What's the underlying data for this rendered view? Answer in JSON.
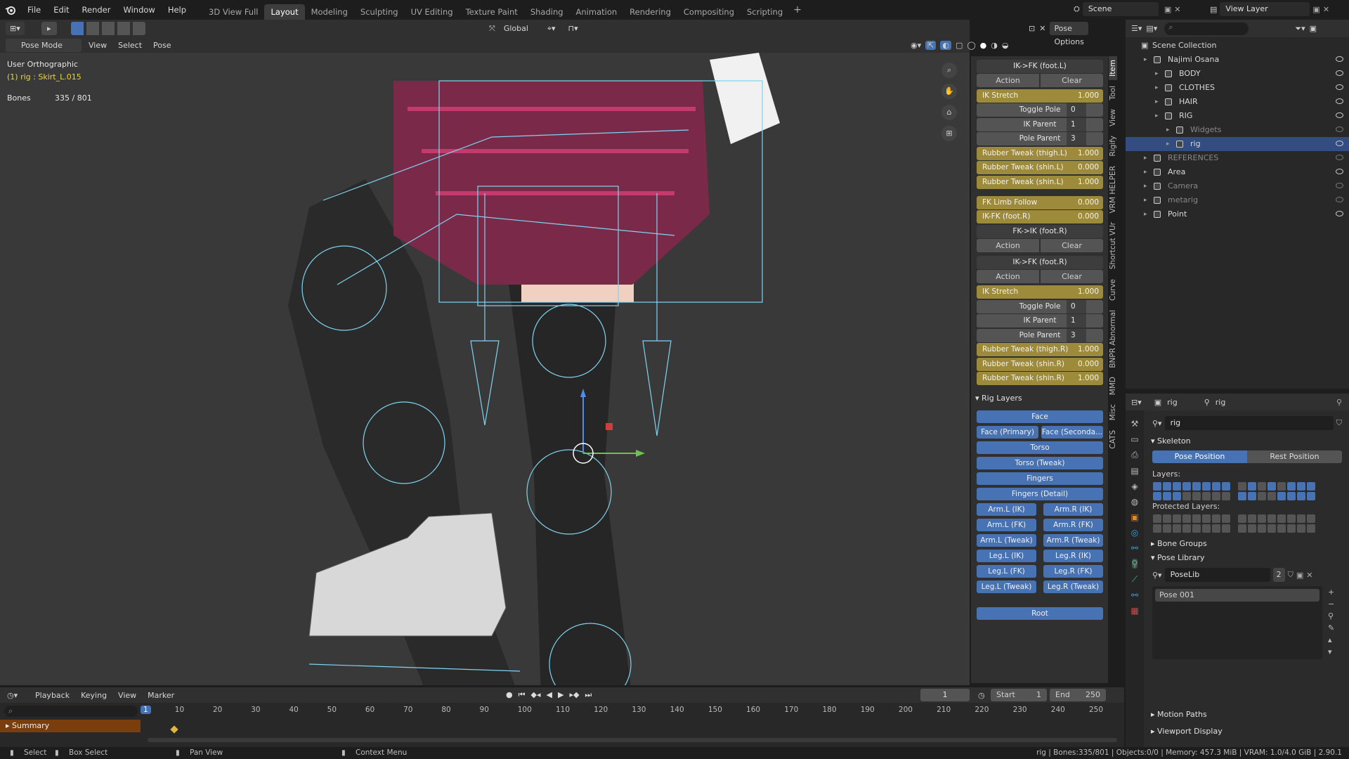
{
  "menu": {
    "file": "File",
    "edit": "Edit",
    "render": "Render",
    "window": "Window",
    "help": "Help"
  },
  "workspaces": [
    "3D View Full",
    "Layout",
    "Modeling",
    "Sculpting",
    "UV Editing",
    "Texture Paint",
    "Shading",
    "Animation",
    "Rendering",
    "Compositing",
    "Scripting"
  ],
  "active_workspace": "Layout",
  "scene": "Scene",
  "view_layer": "View Layer",
  "viewport": {
    "mode": "Pose Mode",
    "menus": [
      "View",
      "Select",
      "Pose"
    ],
    "transform_orientation": "Global",
    "pose_options": "Pose Options",
    "overlay_view": "User Orthographic",
    "overlay_object": "(1) rig : Skirt_L.015",
    "bones_label": "Bones",
    "bones_value": "335 / 801"
  },
  "npanel": {
    "ikfk_foot_l": "IK->FK (foot.L)",
    "action": "Action",
    "clear": "Clear",
    "ik_stretch": "IK Stretch",
    "ik_stretch_val": "1.000",
    "toggle_pole": "Toggle Pole",
    "toggle_pole_val": "0",
    "ik_parent": "IK Parent",
    "ik_parent_val": "1",
    "pole_parent": "Pole Parent",
    "pole_parent_val": "3",
    "rt_thigh_l": "Rubber Tweak (thigh.L)",
    "rt_thigh_l_val": "1.000",
    "rt_shin_l1": "Rubber Tweak (shin.L)",
    "rt_shin_l1_val": "0.000",
    "rt_shin_l2": "Rubber Tweak (shin.L)",
    "rt_shin_l2_val": "1.000",
    "fk_limb_follow": "FK Limb Follow",
    "fk_limb_follow_val": "0.000",
    "ikfk_foot_r_slider": "IK-FK (foot.R)",
    "ikfk_foot_r_slider_val": "0.000",
    "fkik_foot_r": "FK->IK (foot.R)",
    "ikfk_foot_r": "IK->FK (foot.R)",
    "ik_stretch2_val": "1.000",
    "toggle_pole2_val": "0",
    "ik_parent2_val": "1",
    "pole_parent2_val": "3",
    "rt_thigh_r": "Rubber Tweak (thigh.R)",
    "rt_thigh_r_val": "1.000",
    "rt_shin_r1": "Rubber Tweak (shin.R)",
    "rt_shin_r1_val": "0.000",
    "rt_shin_r2": "Rubber Tweak (shin.R)",
    "rt_shin_r2_val": "1.000",
    "rig_layers": "Rig Layers",
    "layers": {
      "face": "Face",
      "face_primary": "Face (Primary)",
      "face_secondary": "Face (Seconda...",
      "torso": "Torso",
      "torso_tweak": "Torso (Tweak)",
      "fingers": "Fingers",
      "fingers_detail": "Fingers (Detail)",
      "arm_l_ik": "Arm.L (IK)",
      "arm_r_ik": "Arm.R (IK)",
      "arm_l_fk": "Arm.L (FK)",
      "arm_r_fk": "Arm.R (FK)",
      "arm_l_tweak": "Arm.L (Tweak)",
      "arm_r_tweak": "Arm.R (Tweak)",
      "leg_l_ik": "Leg.L (IK)",
      "leg_r_ik": "Leg.R (IK)",
      "leg_l_fk": "Leg.L (FK)",
      "leg_r_fk": "Leg.R (FK)",
      "leg_l_tweak": "Leg.L (Tweak)",
      "leg_r_tweak": "Leg.R (Tweak)",
      "root": "Root"
    },
    "tabs": [
      "Item",
      "Tool",
      "View",
      "Rigify",
      "VRM HELPER",
      "Shortcut VUr",
      "Curve",
      "BNPR Abnormal",
      "MMD",
      "Misc",
      "CATS"
    ]
  },
  "outliner": {
    "scene_collection": "Scene Collection",
    "rows": [
      {
        "label": "Najimi Osana",
        "indent": 1
      },
      {
        "label": "BODY",
        "indent": 2
      },
      {
        "label": "CLOTHES",
        "indent": 2
      },
      {
        "label": "HAIR",
        "indent": 2
      },
      {
        "label": "RIG",
        "indent": 2
      },
      {
        "label": "Widgets",
        "indent": 3
      },
      {
        "label": "rig",
        "indent": 3
      },
      {
        "label": "REFERENCES",
        "indent": 1
      },
      {
        "label": "Area",
        "indent": 1
      },
      {
        "label": "Camera",
        "indent": 1
      },
      {
        "label": "metarig",
        "indent": 1
      },
      {
        "label": "Point",
        "indent": 1
      }
    ]
  },
  "properties": {
    "object": "rig",
    "data": "rig",
    "data_field": "rig",
    "skeleton": "Skeleton",
    "pose_position": "Pose Position",
    "rest_position": "Rest Position",
    "layers": "Layers:",
    "protected_layers": "Protected Layers:",
    "bone_groups": "Bone Groups",
    "pose_library": "Pose Library",
    "poselib": "PoseLib",
    "poselib_users": "2",
    "pose_001": "Pose 001",
    "motion_paths": "Motion Paths",
    "viewport_display": "Viewport Display"
  },
  "timeline": {
    "menus": [
      "Playback",
      "Keying",
      "View",
      "Marker"
    ],
    "current_frame": "1",
    "start_label": "Start",
    "start": "1",
    "end_label": "End",
    "end": "250",
    "ruler": [
      "1",
      "10",
      "20",
      "30",
      "40",
      "50",
      "60",
      "70",
      "80",
      "90",
      "100",
      "110",
      "120",
      "130",
      "140",
      "150",
      "160",
      "170",
      "180",
      "190",
      "200",
      "210",
      "220",
      "230",
      "240",
      "250"
    ],
    "summary": "Summary"
  },
  "status": {
    "select": "Select",
    "box_select": "Box Select",
    "pan_view": "Pan View",
    "context_menu": "Context Menu",
    "info": "rig | Bones:335/801 | Objects:0/0 | Memory: 457.3 MiB | VRAM: 1.0/4.0 GiB | 2.90.1"
  }
}
